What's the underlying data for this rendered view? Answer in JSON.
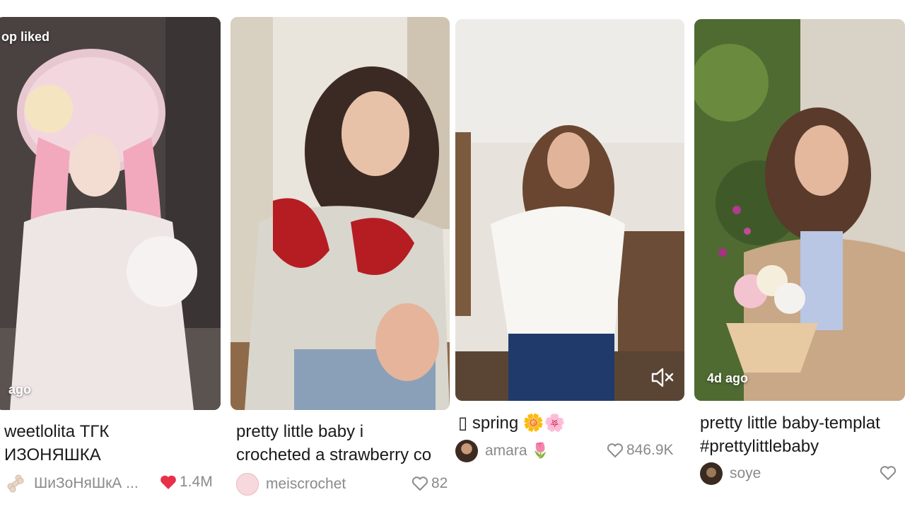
{
  "cards": [
    {
      "overlay_top": "op liked",
      "overlay_bottom": "ago",
      "caption_line1": "weetlolita ТГК",
      "caption_line2": "ИЗОНЯШКА",
      "author": "ШиЗоНяШкА ...",
      "likes": "1.4M",
      "liked": true
    },
    {
      "caption_line1": "pretty little baby i",
      "caption_line2": "crocheted a strawberry co",
      "author": "meiscrochet",
      "likes": "82",
      "liked": false
    },
    {
      "caption_line1": "▯ spring 🌼🌸",
      "author": "amara 🌷",
      "likes": "846.9K",
      "liked": false,
      "muted": true
    },
    {
      "overlay_bottom": "4d ago",
      "caption_line1": "pretty little baby-templat",
      "caption_line2": "#prettylittlebaby",
      "author": "soye",
      "likes": "",
      "liked": false
    }
  ],
  "colors": {
    "liked_heart": "#e8304a",
    "unliked_heart": "#8a8a8a",
    "caption_text": "#1a1a1a",
    "meta_text": "#8a8a8a"
  },
  "icons": [
    "heart-filled-icon",
    "heart-outline-icon",
    "mute-icon",
    "bone-icon"
  ]
}
